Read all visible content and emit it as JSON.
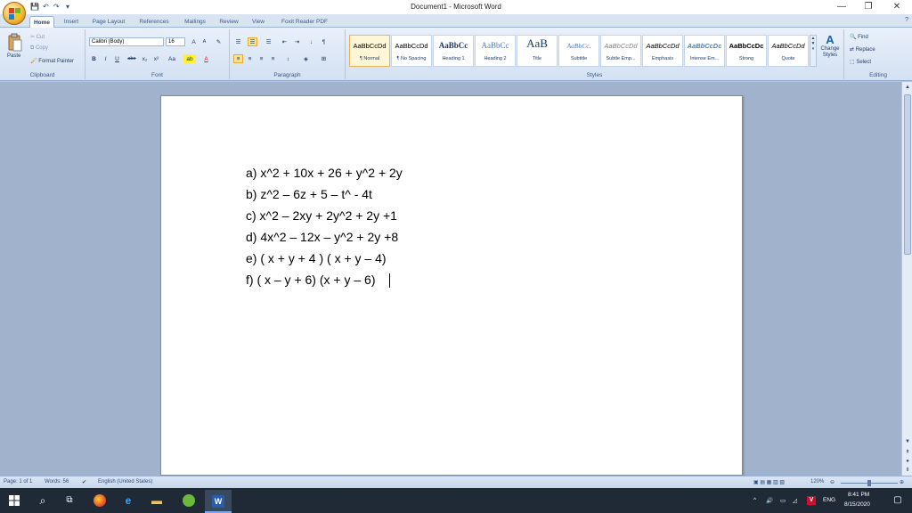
{
  "window": {
    "title": "Document1 - Microsoft Word"
  },
  "quick_access": {
    "save": "💾",
    "undo": "↶",
    "redo": "↷",
    "more": "▾"
  },
  "window_controls": {
    "minimize": "—",
    "restore": "❐",
    "close": "✕"
  },
  "tabs": [
    "Home",
    "Insert",
    "Page Layout",
    "References",
    "Mailings",
    "Review",
    "View",
    "Foxit Reader PDF"
  ],
  "clipboard": {
    "paste": "Paste",
    "cut": "Cut",
    "copy": "Copy",
    "format_painter": "Format Painter",
    "label": "Clipboard"
  },
  "font": {
    "name": "Calibri (Body)",
    "size": "16",
    "grow": "A",
    "shrink": "A",
    "clear": "✎",
    "bold": "B",
    "italic": "I",
    "underline": "U",
    "strike": "abe",
    "subscript": "x₂",
    "superscript": "x²",
    "case": "Aa",
    "highlight": "ab",
    "color": "A",
    "label": "Font"
  },
  "paragraph": {
    "bullets": "☰",
    "numbering": "☰",
    "multilevel": "☰",
    "dec_indent": "⇤",
    "inc_indent": "⇥",
    "sort": "↓",
    "pilcrow": "¶",
    "align_left": "≡",
    "center": "≡",
    "align_right": "≡",
    "justify": "≡",
    "spacing": "↕",
    "shading": "◈",
    "borders": "⊞",
    "label": "Paragraph"
  },
  "styles": {
    "items": [
      {
        "sample": "AaBbCcDd",
        "name": "¶ Normal"
      },
      {
        "sample": "AaBbCcDd",
        "name": "¶ No Spacing"
      },
      {
        "sample": "AaBbCc",
        "name": "Heading 1"
      },
      {
        "sample": "AaBbCc",
        "name": "Heading 2"
      },
      {
        "sample": "AaB",
        "name": "Title"
      },
      {
        "sample": "AaBbCc.",
        "name": "Subtitle"
      },
      {
        "sample": "AaBbCcDd",
        "name": "Subtle Emp..."
      },
      {
        "sample": "AaBbCcDd",
        "name": "Emphasis"
      },
      {
        "sample": "AaBbCcDc",
        "name": "Intense Em..."
      },
      {
        "sample": "AaBbCcDc",
        "name": "Strong"
      },
      {
        "sample": "AaBbCcDd",
        "name": "Quote"
      }
    ],
    "change_styles": "Change Styles",
    "label": "Styles"
  },
  "editing": {
    "find": "Find",
    "replace": "Replace",
    "select": "Select",
    "label": "Editing"
  },
  "document": {
    "lines": [
      "a)  x^2 + 10x + 26 + y^2 + 2y",
      "b)  z^2 – 6z + 5 – t^ - 4t",
      "c)  x^2 – 2xy + 2y^2 + 2y +1",
      "d)  4x^2 – 12x – y^2 + 2y +8",
      "e)  ( x + y + 4 ) ( x + y – 4)",
      "f)   ( x – y + 6) (x + y – 6)"
    ]
  },
  "status": {
    "page": "Page: 1 of 1",
    "words": "Words: 56",
    "language": "English (United States)",
    "zoom": "120%"
  },
  "taskbar": {
    "time": "8:41 PM",
    "date": "8/15/2020",
    "lang": "ENG"
  }
}
